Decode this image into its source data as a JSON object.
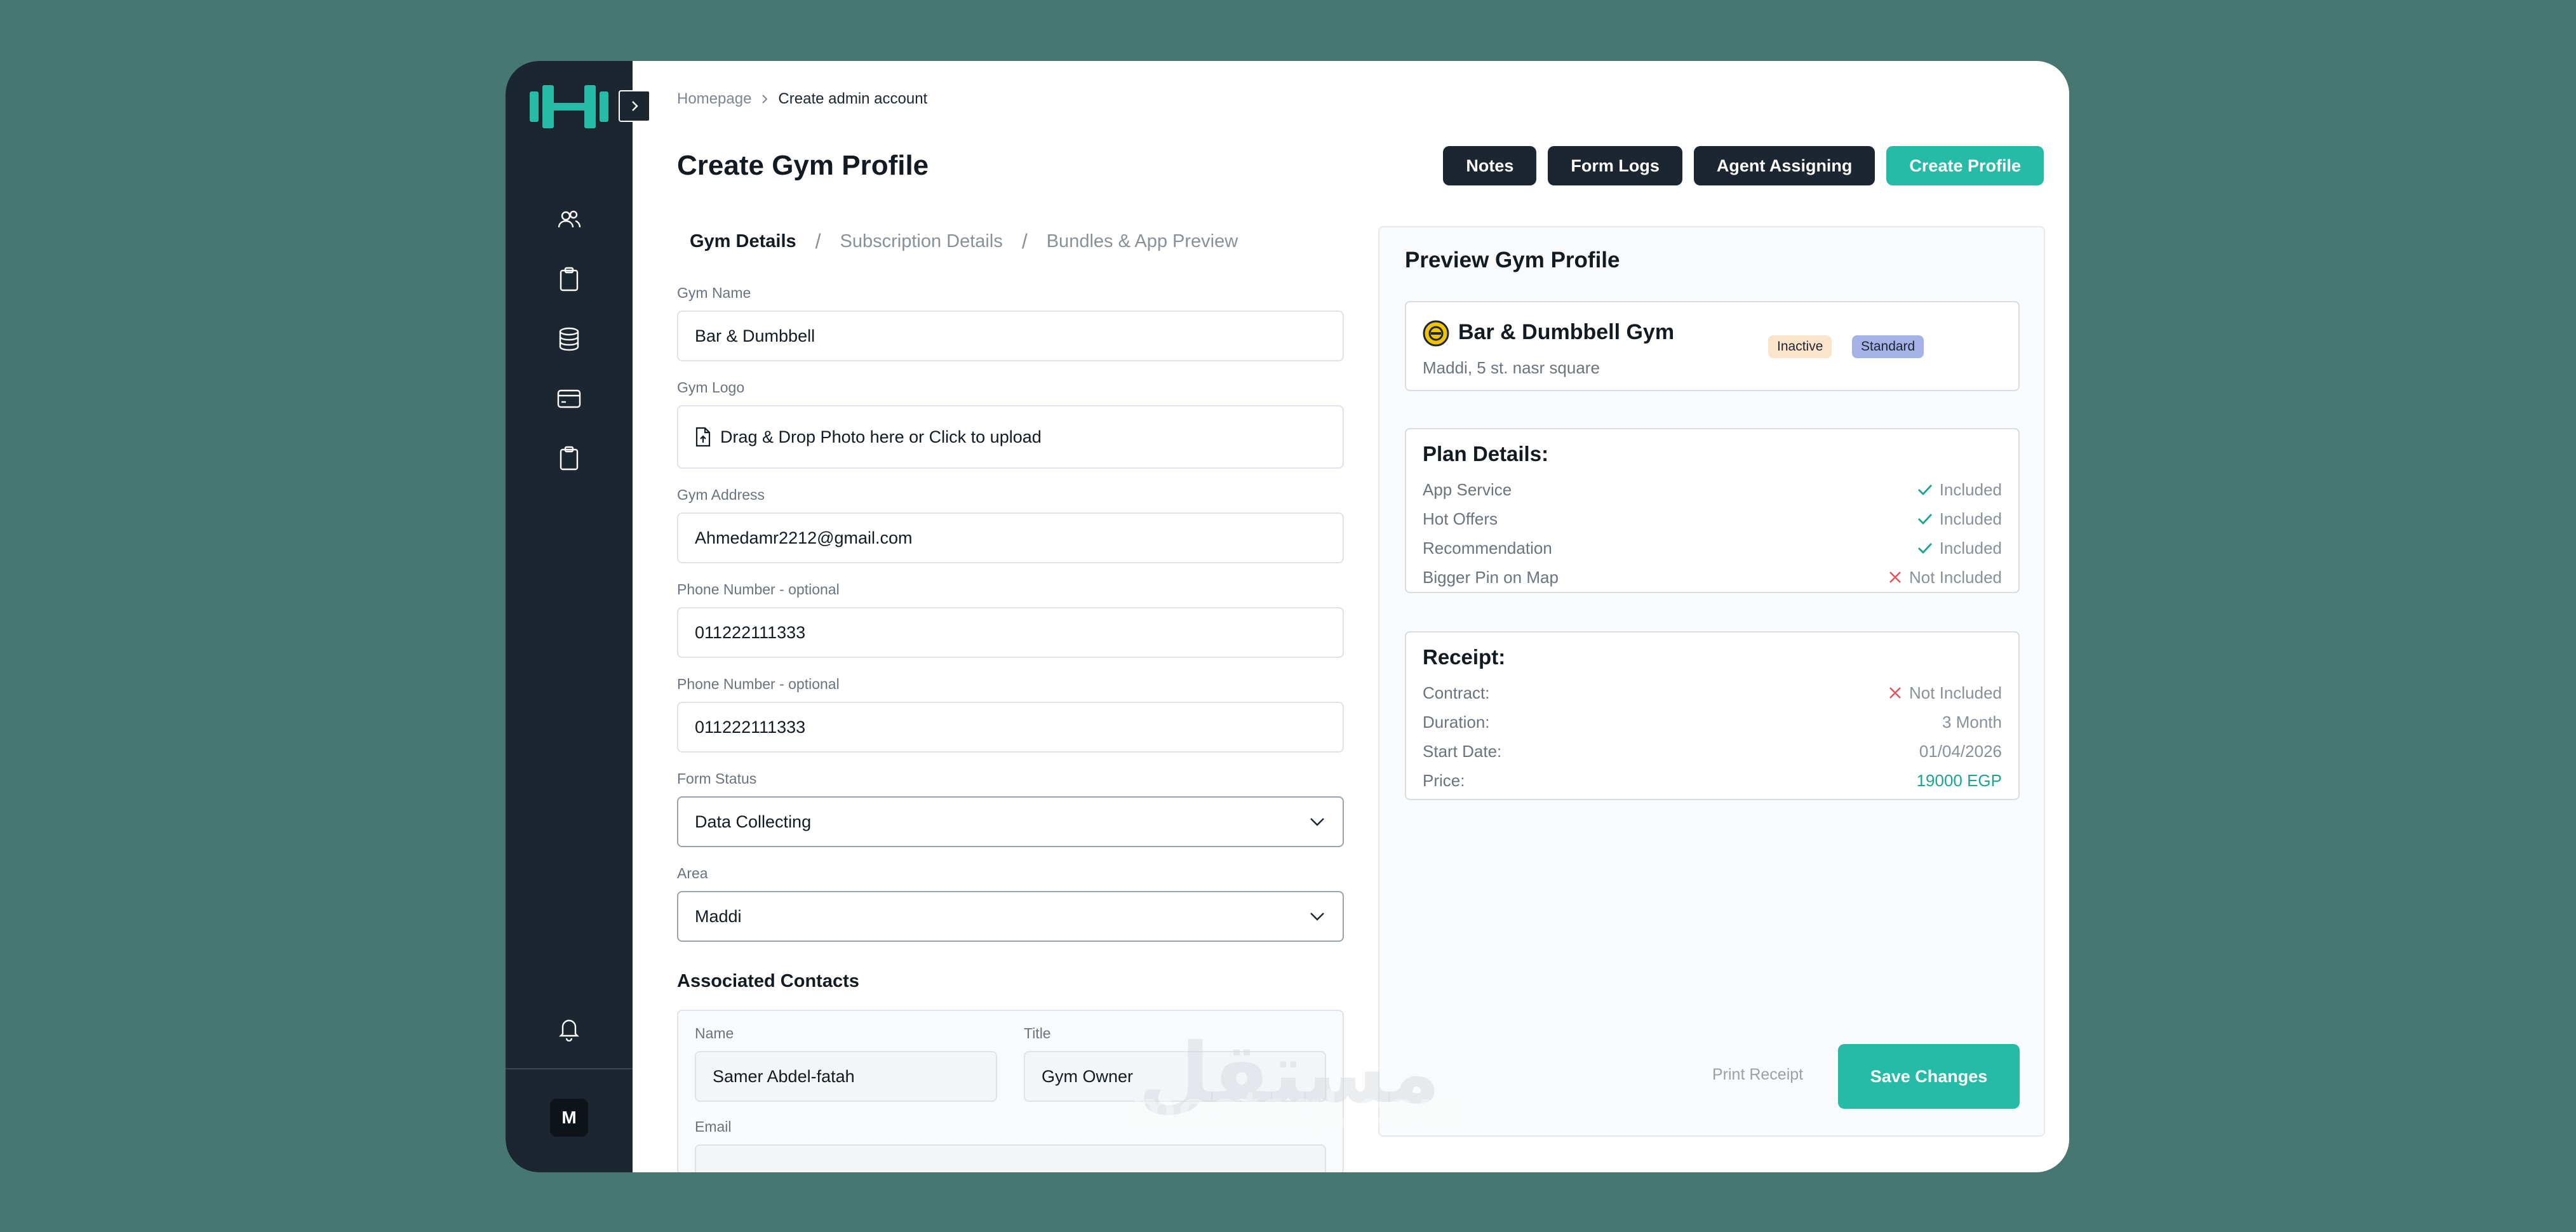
{
  "breadcrumb": {
    "home": "Homepage",
    "current": "Create admin account"
  },
  "page": {
    "title": "Create Gym Profile"
  },
  "actions": {
    "notes": "Notes",
    "form_logs": "Form Logs",
    "agent_assigning": "Agent Assigning",
    "create_profile": "Create Profile"
  },
  "tabs": [
    "Gym Details",
    "Subscription Details",
    "Bundles & App Preview"
  ],
  "tab_separator": "/",
  "form": {
    "gym_name": {
      "label": "Gym Name",
      "value": "Bar & Dumbbell"
    },
    "gym_logo": {
      "label": "Gym Logo",
      "placeholder": "Drag & Drop Photo here or Click to upload"
    },
    "gym_address": {
      "label": "Gym Address",
      "value": "Ahmedamr2212@gmail.com"
    },
    "phone_1": {
      "label": "Phone Number - optional",
      "value": "011222111333"
    },
    "phone_2": {
      "label": "Phone Number - optional",
      "value": "011222111333"
    },
    "form_status": {
      "label": "Form Status",
      "value": "Data Collecting"
    },
    "area": {
      "label": "Area",
      "value": "Maddi"
    }
  },
  "contacts": {
    "title": "Associated Contacts",
    "name_label": "Name",
    "name_value": "Samer Abdel-fatah",
    "title_label": "Title",
    "title_value": "Gym Owner",
    "email_label": "Email"
  },
  "preview": {
    "title": "Preview Gym Profile",
    "gym": {
      "name": "Bar & Dumbbell Gym",
      "address": "Maddi, 5 st. nasr square",
      "badge_status": "Inactive",
      "badge_plan": "Standard"
    },
    "plan": {
      "heading": "Plan Details:",
      "rows": [
        {
          "label": "App Service",
          "status": "Included",
          "included": true
        },
        {
          "label": "Hot Offers",
          "status": "Included",
          "included": true
        },
        {
          "label": "Recommendation",
          "status": "Included",
          "included": true
        },
        {
          "label": "Bigger Pin on Map",
          "status": "Not Included",
          "included": false
        }
      ]
    },
    "receipt": {
      "heading": "Receipt:",
      "contract_label": "Contract:",
      "contract_value": "Not Included",
      "duration_label": "Duration:",
      "duration_value": "3 Month",
      "start_label": "Start Date:",
      "start_value": "01/04/2026",
      "price_label": "Price:",
      "price_value": "19000 EGP"
    },
    "print": "Print  Receipt",
    "save": "Save Changes"
  },
  "sidebar": {
    "avatar": "M",
    "icons": [
      "users-icon",
      "clipboard-icon",
      "database-icon",
      "credit-card-icon",
      "clipboard-icon",
      "bell-icon"
    ]
  },
  "watermark": {
    "arabic": "مستقل",
    "latin": "mostaql.com"
  },
  "colors": {
    "accent": "#25bba6",
    "dark": "#1c2630",
    "background": "#467871"
  }
}
